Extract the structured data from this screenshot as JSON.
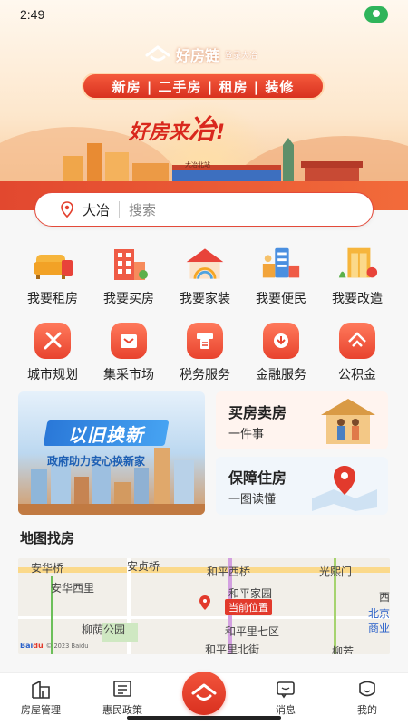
{
  "status": {
    "time": "2:49"
  },
  "hero": {
    "brand_name": "好房链",
    "brand_sub": "登录大冶",
    "ribbon": "新房 | 二手房 | 租房 | 装修",
    "slogan_a": "好房来",
    "slogan_b": "冶",
    "slogan_c": "!",
    "city_sign": "大冶北站"
  },
  "search": {
    "city": "大冶",
    "placeholder": "搜索"
  },
  "services_primary": [
    {
      "label": "我要租房",
      "icon": "sofa-icon"
    },
    {
      "label": "我要买房",
      "icon": "building-icon"
    },
    {
      "label": "我要家装",
      "icon": "house-rainbow-icon"
    },
    {
      "label": "我要便民",
      "icon": "community-icon"
    },
    {
      "label": "我要改造",
      "icon": "elevator-renovation-icon"
    }
  ],
  "services_secondary": [
    {
      "label": "城市规划",
      "icon": "planning-icon"
    },
    {
      "label": "集采市场",
      "icon": "market-icon"
    },
    {
      "label": "税务服务",
      "icon": "tax-icon"
    },
    {
      "label": "金融服务",
      "icon": "finance-icon"
    },
    {
      "label": "公积金",
      "icon": "fund-icon"
    }
  ],
  "promo": {
    "badge": "以旧换新",
    "subtitle": "政府助力安心换新家"
  },
  "card_buy_sell": {
    "title": "买房卖房",
    "desc": "一件事"
  },
  "card_housing": {
    "title": "保障住房",
    "desc": "一图读懂"
  },
  "map_section": {
    "title": "地图找房",
    "labels": [
      "安华桥",
      "安贞桥",
      "和平西桥",
      "光熙门",
      "安华西里",
      "和平家园",
      "柳荫公园",
      "和平里七区",
      "和平里北街",
      "西",
      "北京",
      "商业",
      "柳芳"
    ],
    "current_position": "当前位置",
    "attribution": "© 2023 Baidu"
  },
  "tabbar": [
    {
      "label": "房屋管理",
      "icon": "house-manage-icon"
    },
    {
      "label": "惠民政策",
      "icon": "policy-icon"
    },
    {
      "label": "",
      "icon": "home-center-icon"
    },
    {
      "label": "消息",
      "icon": "message-icon"
    },
    {
      "label": "我的",
      "icon": "profile-icon"
    }
  ],
  "colors": {
    "accent": "#e3402e",
    "status_pill": "#2fb45a"
  }
}
